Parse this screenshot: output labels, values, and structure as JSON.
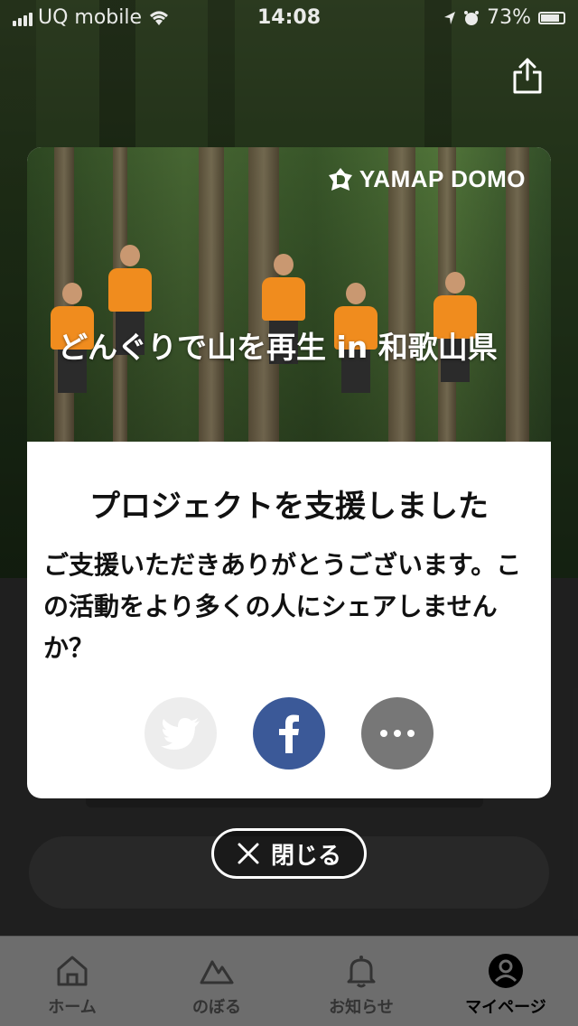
{
  "status_bar": {
    "carrier": "UQ mobile",
    "time": "14:08",
    "battery": "73%"
  },
  "modal": {
    "brand": "YAMAP DOMO",
    "hero_title": "どんぐりで山を再生 in 和歌山県",
    "title": "プロジェクトを支援しました",
    "message": "ご支援いただきありがとうございます。この活動をより多くの人にシェアしませんか？",
    "share_buttons": [
      {
        "icon": "twitter-icon",
        "color": "#ededed"
      },
      {
        "icon": "facebook-icon",
        "color": "#3b5998"
      },
      {
        "icon": "more-icon",
        "color": "#777777"
      }
    ]
  },
  "close_button": {
    "label": "閉じる"
  },
  "tab_bar": {
    "items": [
      {
        "label": "ホーム",
        "icon": "home-icon"
      },
      {
        "label": "のぼる",
        "icon": "mountain-icon"
      },
      {
        "label": "お知らせ",
        "icon": "bell-icon"
      },
      {
        "label": "マイページ",
        "icon": "user-icon",
        "active": true
      }
    ]
  }
}
